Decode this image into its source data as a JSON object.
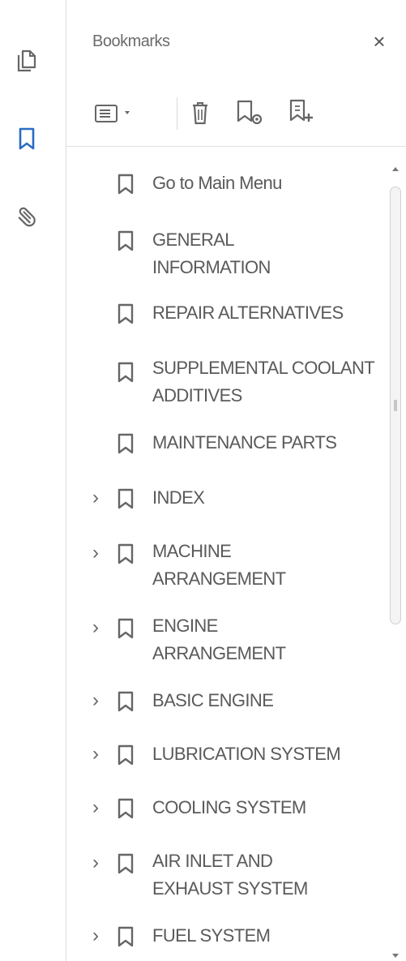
{
  "panel": {
    "title": "Bookmarks",
    "close_label": "×"
  },
  "rail": {
    "items": [
      {
        "icon": "pages-icon",
        "active": false
      },
      {
        "icon": "bookmark-icon",
        "active": true
      },
      {
        "icon": "attachment-icon",
        "active": false
      }
    ]
  },
  "toolbar": {
    "buttons": [
      {
        "icon": "options-menu-icon"
      },
      {
        "icon": "delete-icon"
      },
      {
        "icon": "new-bookmark-icon"
      },
      {
        "icon": "expand-bookmark-icon"
      }
    ]
  },
  "bookmarks": {
    "items": [
      {
        "label": "Go to Main Menu",
        "expandable": false
      },
      {
        "label": "GENERAL INFORMATION",
        "expandable": false
      },
      {
        "label": "REPAIR ALTERNATIVES",
        "expandable": false
      },
      {
        "label": "SUPPLEMENTAL COOLANT ADDITIVES",
        "expandable": false
      },
      {
        "label": "MAINTENANCE PARTS",
        "expandable": false
      },
      {
        "label": "INDEX",
        "expandable": true
      },
      {
        "label": "MACHINE ARRANGEMENT",
        "expandable": true
      },
      {
        "label": "ENGINE ARRANGEMENT",
        "expandable": true
      },
      {
        "label": "BASIC ENGINE",
        "expandable": true
      },
      {
        "label": "LUBRICATION SYSTEM",
        "expandable": true
      },
      {
        "label": "COOLING SYSTEM",
        "expandable": true
      },
      {
        "label": "AIR INLET AND EXHAUST SYSTEM",
        "expandable": true
      },
      {
        "label": "FUEL SYSTEM",
        "expandable": true
      }
    ],
    "chevron": "›"
  },
  "colors": {
    "accent": "#2b6cc4",
    "icon_gray": "#666666",
    "text": "#5a5a5a"
  }
}
